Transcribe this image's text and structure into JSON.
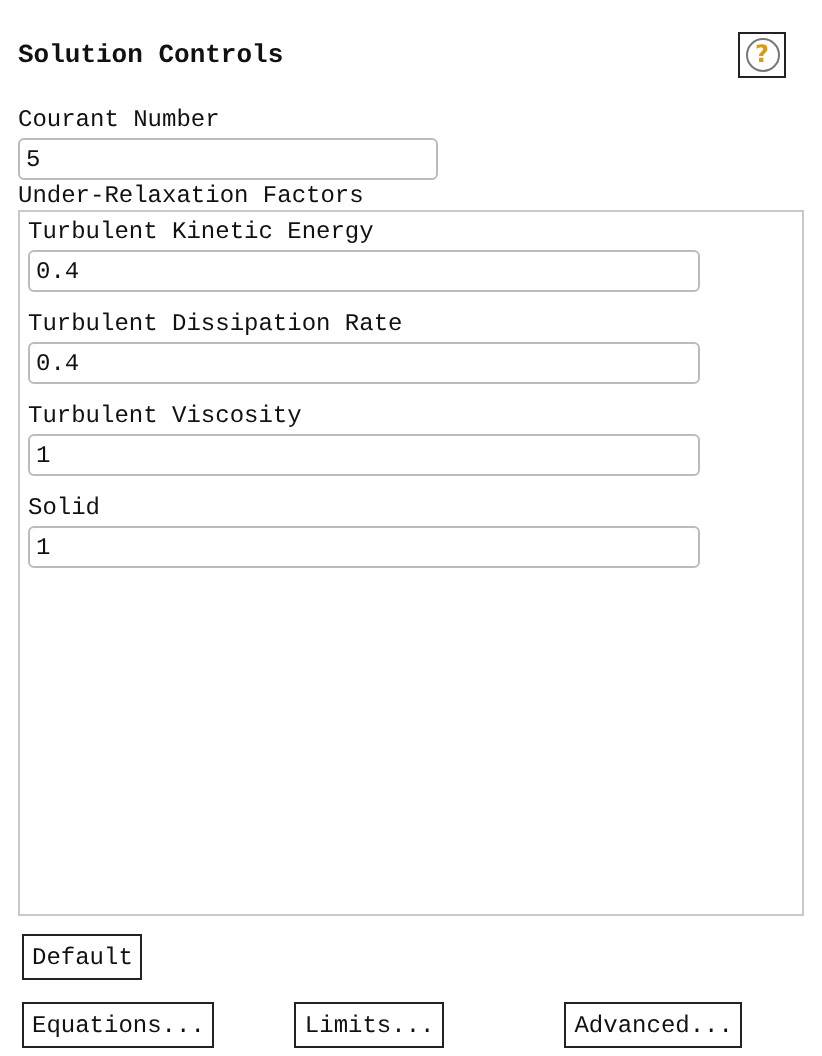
{
  "title": "Solution Controls",
  "help_button": {
    "label": "?"
  },
  "courant": {
    "label": "Courant Number",
    "value": "5"
  },
  "under_relaxation": {
    "title": "Under-Relaxation Factors",
    "factors": [
      {
        "label": "Turbulent Kinetic Energy",
        "value": "0.4"
      },
      {
        "label": "Turbulent Dissipation Rate",
        "value": "0.4"
      },
      {
        "label": "Turbulent Viscosity",
        "value": "1"
      },
      {
        "label": "Solid",
        "value": "1"
      }
    ]
  },
  "default_button": "Default",
  "buttons": [
    "Equations...",
    "Limits...",
    "Advanced..."
  ]
}
